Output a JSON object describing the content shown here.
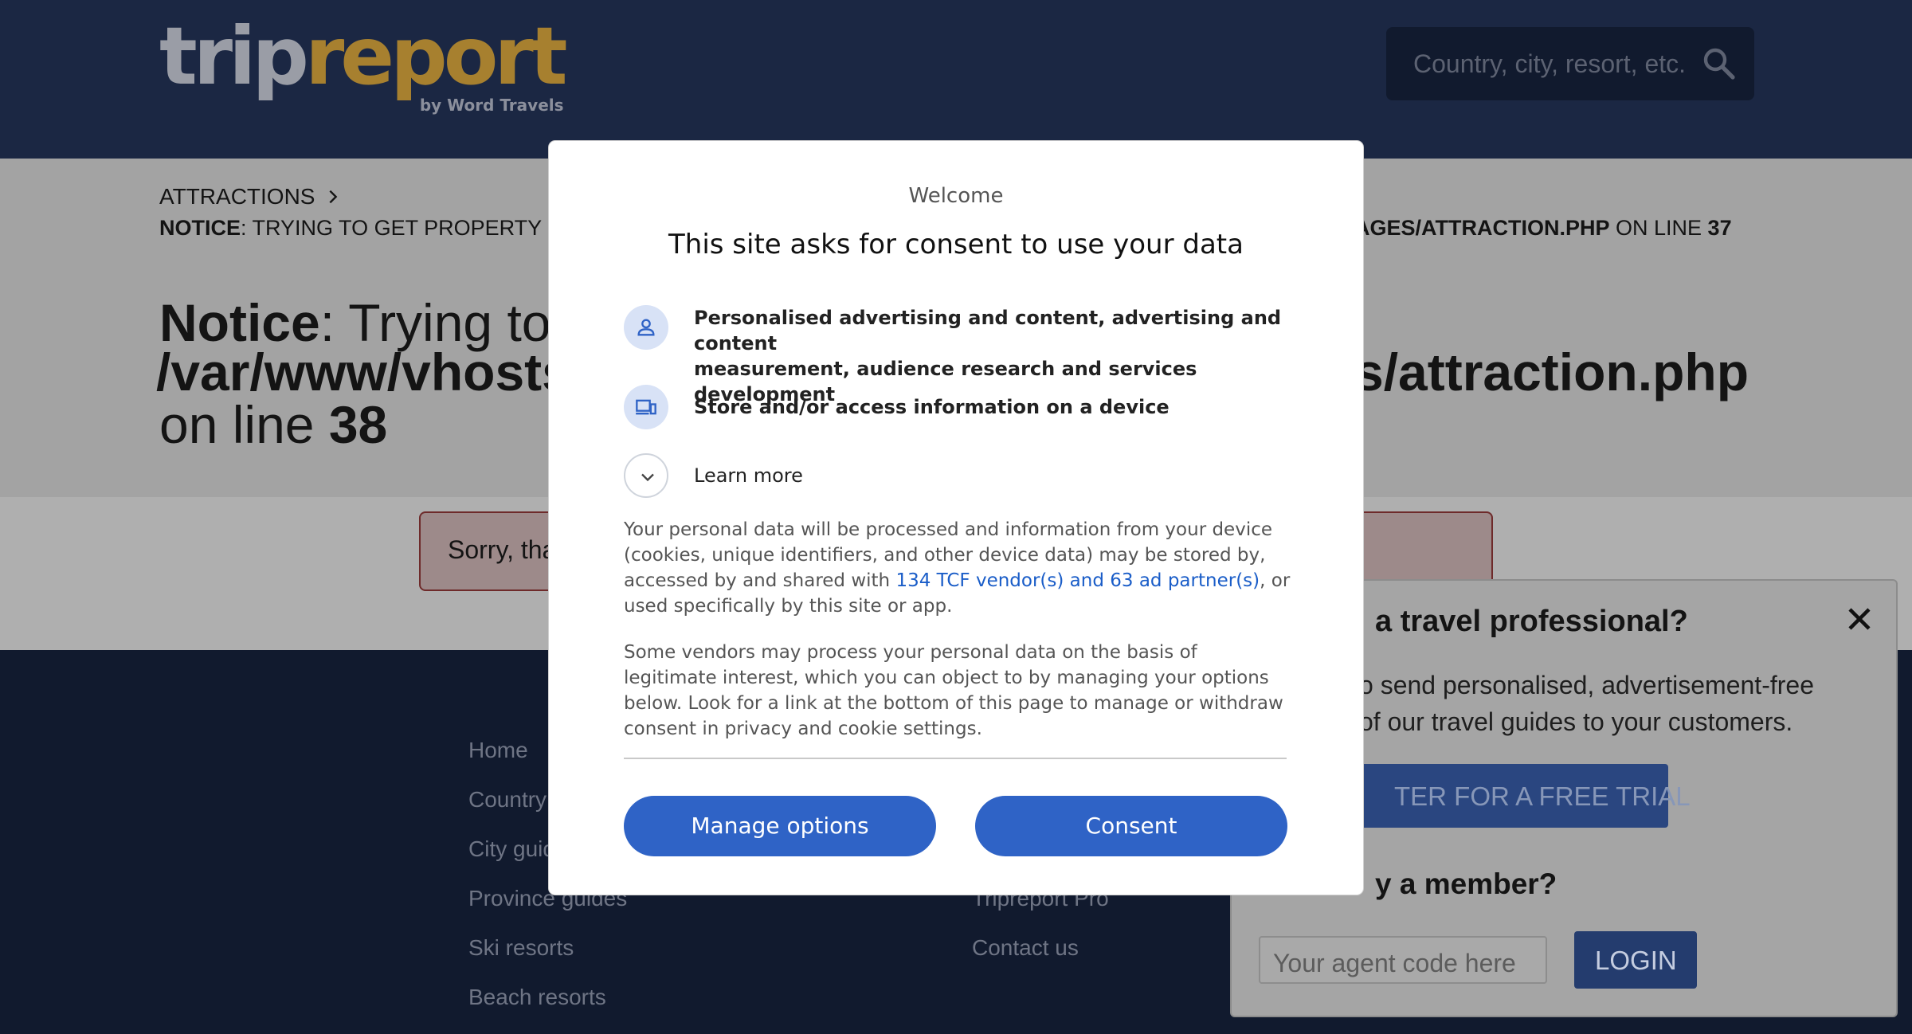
{
  "header": {
    "logo_trip": "trip",
    "logo_report": "report",
    "logo_by": "by Word Travels",
    "search_placeholder": "Country, city, resort, etc."
  },
  "page": {
    "breadcrumb": "ATTRACTIONS",
    "notice_small_bold": "NOTICE",
    "notice_small_text": ": TRYING TO GET PROPERTY",
    "notice_small_right_bold": "AGES/ATTRACTION.PHP",
    "notice_small_right_text": " ON LINE ",
    "notice_small_right_line": "37",
    "notice_big_bold": "Notice",
    "notice_big_text": ": Trying to",
    "notice_path_left": "/var/www/vhosts",
    "notice_path_right": "s/attraction.php",
    "notice_line_text": "on line ",
    "notice_line_num": "38",
    "sorry_text": "Sorry, tha"
  },
  "footer": {
    "left_links": [
      "Home",
      "Country",
      "City guid",
      "Province guides",
      "Ski resorts",
      "Beach resorts"
    ],
    "right_links": [
      "Tripreport Pro",
      "Contact us"
    ]
  },
  "pro_panel": {
    "title": "a travel professional?",
    "desc_line1": "o send personalised, advertisement-free",
    "desc_line2": "of our travel guides to your customers.",
    "trial_label": "TER FOR A FREE TRIAL",
    "member_title": "y a member?",
    "agent_placeholder": "Your agent code here",
    "login_label": "LOGIN"
  },
  "consent": {
    "welcome": "Welcome",
    "headline": "This site asks for consent to use your data",
    "purpose1_line1": "Personalised advertising and content, advertising and content",
    "purpose1_line2": "measurement, audience research and services development",
    "purpose2": "Store and/or access information on a device",
    "learn_more": "Learn more",
    "para1_pre": "Your personal data will be processed and information from your device (cookies, unique identifiers, and other device data) may be stored by, accessed by and shared with ",
    "para1_link": "134 TCF vendor(s) and 63 ad partner(s)",
    "para1_post": ", or used specifically by this site or app.",
    "para2": "Some vendors may process your personal data on the basis of legitimate interest, which you can object to by managing your options below. Look for a link at the bottom of this page to manage or withdraw consent in privacy and cookie settings.",
    "manage_label": "Manage options",
    "consent_label": "Consent",
    "accent_color": "#2f63c6"
  }
}
